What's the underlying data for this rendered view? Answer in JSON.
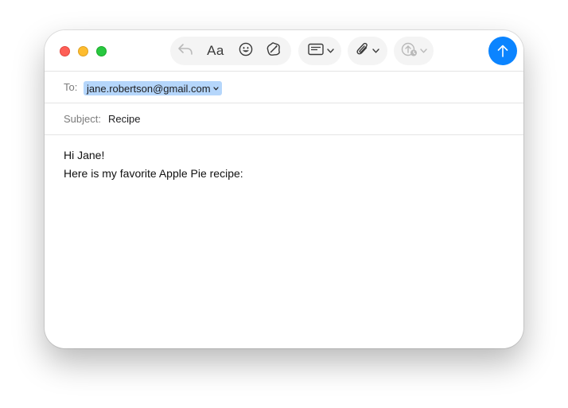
{
  "window": {
    "traffic_lights": [
      {
        "name": "close",
        "color": "#fe5f57"
      },
      {
        "name": "minimize",
        "color": "#febc2e"
      },
      {
        "name": "zoom",
        "color": "#28c840"
      }
    ]
  },
  "toolbar": {
    "reply_icon": "reply-arrow-icon",
    "format_label": "Aa",
    "emoji_icon": "smiley-icon",
    "writing_tools_icon": "writing-tools-icon",
    "header_fields_icon": "header-fields-icon",
    "attachment_icon": "paperclip-icon",
    "send_later_icon": "send-later-icon",
    "send_icon": "send-arrow-up-icon",
    "accent_color": "#0b84ff"
  },
  "compose": {
    "to_label": "To:",
    "to_recipient": "jane.robertson@gmail.com",
    "subject_label": "Subject:",
    "subject_value": "Recipe",
    "body_lines": [
      "Hi Jane!",
      "Here is my favorite Apple Pie recipe:"
    ]
  }
}
